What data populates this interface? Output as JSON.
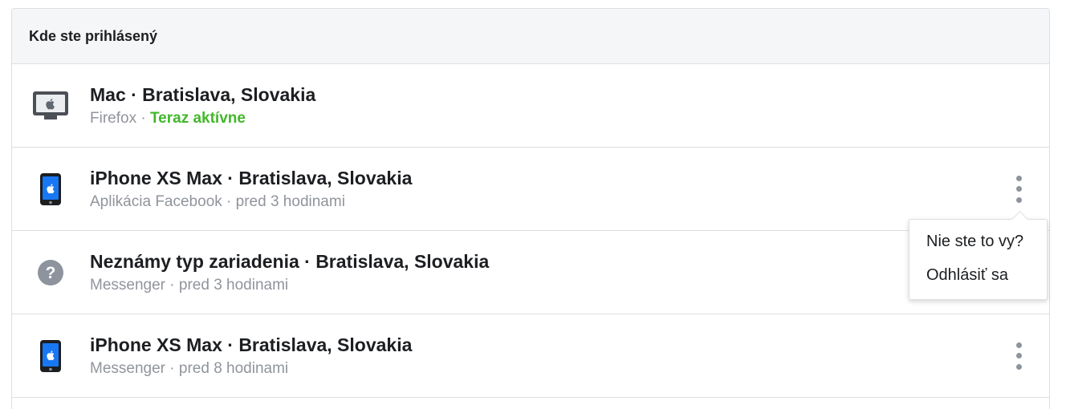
{
  "panel": {
    "title": "Kde ste prihlásený"
  },
  "sessions": [
    {
      "device_icon": "desktop-mac-icon",
      "title": "Mac · Bratislava, Slovakia",
      "client": "Firefox",
      "separator": " · ",
      "status": "Teraz aktívne",
      "status_active": true,
      "has_menu": false
    },
    {
      "device_icon": "iphone-icon",
      "title": "iPhone XS Max · Bratislava, Slovakia",
      "client": "Aplikácia Facebook",
      "separator": " · ",
      "status": "pred 3 hodinami",
      "status_active": false,
      "has_menu": true
    },
    {
      "device_icon": "unknown-device-icon",
      "title": "Neznámy typ zariadenia · Bratislava, Slovakia",
      "client": "Messenger",
      "separator": " · ",
      "status": "pred 3 hodinami",
      "status_active": false,
      "has_menu": false
    },
    {
      "device_icon": "iphone-icon",
      "title": "iPhone XS Max · Bratislava, Slovakia",
      "client": "Messenger",
      "separator": " · ",
      "status": "pred 8 hodinami",
      "status_active": false,
      "has_menu": true
    }
  ],
  "context_menu": {
    "items": [
      {
        "label": "Nie ste to vy?"
      },
      {
        "label": "Odhlásiť sa"
      }
    ]
  },
  "colors": {
    "active_status": "#42b72a",
    "secondary_text": "#90949c",
    "primary_text": "#1c1e21",
    "iphone_blue": "#1877f2"
  }
}
